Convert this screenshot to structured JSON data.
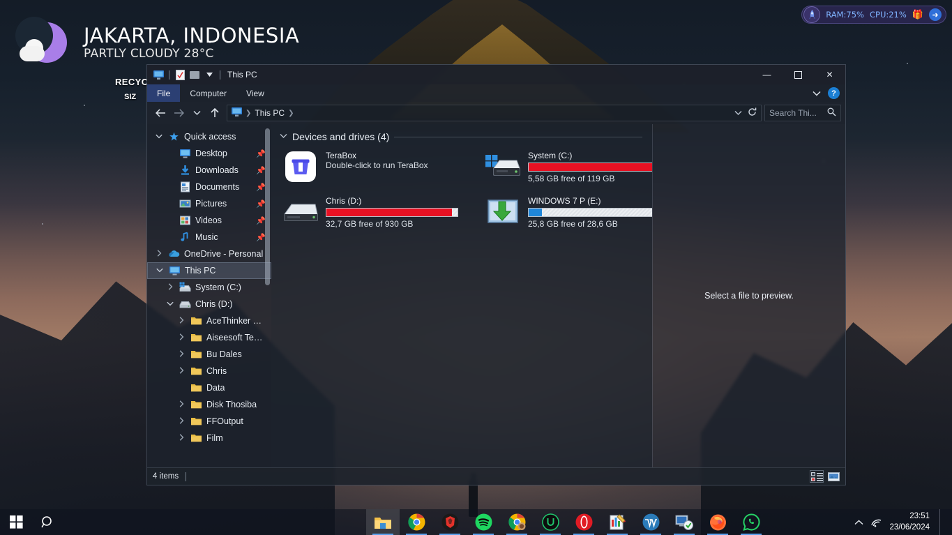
{
  "desktop": {
    "weather": {
      "icon": "moon-cloud-icon",
      "city": "JAKARTA, INDONESIA",
      "condition": "PARTLY CLOUDY 28°C"
    },
    "recycle_bin": {
      "label": "RECYC",
      "size_label": "SIZ"
    },
    "system_monitor": {
      "badge_icon": "rocket-icon",
      "ram": "RAM:75%",
      "cpu": "CPU:21%",
      "gift_icon": "gift-icon",
      "arrow_icon": "arrow-right-icon",
      "accent": "#7fb3ff"
    }
  },
  "window": {
    "title": "This PC",
    "quick_access_toolbar": [
      {
        "name": "this-pc-icon",
        "icon": "monitor-icon"
      },
      {
        "name": "properties-icon",
        "icon": "document-check-icon"
      },
      {
        "name": "new-folder-icon",
        "icon": "folder-icon"
      },
      {
        "name": "customize-qat-icon",
        "icon": "chevron-down-icon"
      }
    ],
    "controls": {
      "minimize": "—",
      "maximize": "▢",
      "close": "✕"
    },
    "ribbon": {
      "tabs": [
        {
          "label": "File",
          "active": true
        },
        {
          "label": "Computer",
          "active": false
        },
        {
          "label": "View",
          "active": false
        }
      ],
      "collapse_icon": "chevron-down-icon",
      "help_label": "?"
    },
    "address_bar": {
      "back_icon": "arrow-left-icon",
      "forward_icon": "arrow-right-icon",
      "recent_icon": "chevron-down-icon",
      "up_icon": "arrow-up-icon",
      "crumb_icon": "monitor-icon",
      "breadcrumbs": [
        "This PC"
      ],
      "history_icon": "chevron-down-icon",
      "refresh_icon": "refresh-icon",
      "search_placeholder": "Search Thi...",
      "search_value": "",
      "search_icon": "search-icon"
    },
    "nav_pane": {
      "items": [
        {
          "label": "Quick access",
          "icon": "star-pin-icon",
          "chevron": "expanded",
          "indent": 0,
          "pinned": false,
          "selected": false
        },
        {
          "label": "Desktop",
          "icon": "desktop-icon",
          "chevron": "none",
          "indent": 1,
          "pinned": true,
          "selected": false
        },
        {
          "label": "Downloads",
          "icon": "downloads-icon",
          "chevron": "none",
          "indent": 1,
          "pinned": true,
          "selected": false
        },
        {
          "label": "Documents",
          "icon": "documents-icon",
          "chevron": "none",
          "indent": 1,
          "pinned": true,
          "selected": false
        },
        {
          "label": "Pictures",
          "icon": "pictures-icon",
          "chevron": "none",
          "indent": 1,
          "pinned": true,
          "selected": false
        },
        {
          "label": "Videos",
          "icon": "videos-icon",
          "chevron": "none",
          "indent": 1,
          "pinned": true,
          "selected": false
        },
        {
          "label": "Music",
          "icon": "music-icon",
          "chevron": "none",
          "indent": 1,
          "pinned": true,
          "selected": false
        },
        {
          "label": "OneDrive - Personal",
          "icon": "onedrive-icon",
          "chevron": "collapsed",
          "indent": 0,
          "pinned": false,
          "selected": false
        },
        {
          "label": "This PC",
          "icon": "monitor-icon",
          "chevron": "expanded",
          "indent": 0,
          "pinned": false,
          "selected": true
        },
        {
          "label": "System (C:)",
          "icon": "windows-drive-icon",
          "chevron": "collapsed",
          "indent": 1,
          "pinned": false,
          "selected": false
        },
        {
          "label": "Chris (D:)",
          "icon": "drive-icon",
          "chevron": "expanded",
          "indent": 1,
          "pinned": false,
          "selected": false
        },
        {
          "label": "AceThinker Temp",
          "icon": "folder-icon",
          "chevron": "collapsed",
          "indent": 2,
          "pinned": false,
          "selected": false
        },
        {
          "label": "Aiseesoft Temp",
          "icon": "folder-icon",
          "chevron": "collapsed",
          "indent": 2,
          "pinned": false,
          "selected": false
        },
        {
          "label": "Bu Dales",
          "icon": "folder-icon",
          "chevron": "collapsed",
          "indent": 2,
          "pinned": false,
          "selected": false
        },
        {
          "label": "Chris",
          "icon": "folder-icon",
          "chevron": "collapsed",
          "indent": 2,
          "pinned": false,
          "selected": false
        },
        {
          "label": "Data",
          "icon": "folder-icon",
          "chevron": "none",
          "indent": 2,
          "pinned": false,
          "selected": false
        },
        {
          "label": "Disk Thosiba",
          "icon": "folder-icon",
          "chevron": "collapsed",
          "indent": 2,
          "pinned": false,
          "selected": false
        },
        {
          "label": "FFOutput",
          "icon": "folder-icon",
          "chevron": "collapsed",
          "indent": 2,
          "pinned": false,
          "selected": false
        },
        {
          "label": "Film",
          "icon": "folder-icon",
          "chevron": "collapsed",
          "indent": 2,
          "pinned": false,
          "selected": false
        }
      ]
    },
    "content": {
      "group_title": "Devices and drives (4)",
      "group_chevron": "expanded",
      "tiles": [
        {
          "name": "TeraBox",
          "subtitle": "Double-click to run TeraBox",
          "icon": "terabox-icon",
          "has_bar": false
        },
        {
          "name": "System (C:)",
          "subtitle": "5,58 GB free of 119 GB",
          "icon": "windows-drive-icon",
          "has_bar": true,
          "fill_percent": 95,
          "fill_color": "#e81123"
        },
        {
          "name": "Chris (D:)",
          "subtitle": "32,7 GB free of 930 GB",
          "icon": "external-drive-icon",
          "has_bar": true,
          "fill_percent": 96,
          "fill_color": "#e81123"
        },
        {
          "name": "WINDOWS 7 P (E:)",
          "subtitle": "25,8 GB free of 28,6 GB",
          "icon": "recovery-drive-icon",
          "has_bar": true,
          "fill_percent": 10,
          "fill_color": "#1f86d9"
        }
      ]
    },
    "preview_pane": {
      "text": "Select a file to preview."
    },
    "status_bar": {
      "item_count": "4 items",
      "details_view_icon": "details-view-icon",
      "large_icons_view_icon": "large-icons-view-icon"
    }
  },
  "taskbar": {
    "start_icon": "windows-start-icon",
    "search_icon": "search-icon",
    "apps": [
      {
        "name": "file-explorer-icon",
        "active": true,
        "running": true
      },
      {
        "name": "google-chrome-icon",
        "active": false,
        "running": true
      },
      {
        "name": "brave-shield-icon",
        "active": false,
        "running": true
      },
      {
        "name": "spotify-icon",
        "active": false,
        "running": true
      },
      {
        "name": "chrome-profile-icon",
        "active": false,
        "running": true
      },
      {
        "name": "utorrent-icon",
        "active": false,
        "running": true
      },
      {
        "name": "opera-icon",
        "active": false,
        "running": true
      },
      {
        "name": "notepad-chart-icon",
        "active": false,
        "running": true
      },
      {
        "name": "wordpress-icon",
        "active": false,
        "running": true
      },
      {
        "name": "remote-desktop-icon",
        "active": false,
        "running": true
      },
      {
        "name": "firefox-icon",
        "active": false,
        "running": true
      },
      {
        "name": "whatsapp-icon",
        "active": false,
        "running": true
      }
    ],
    "tray": {
      "expand_icon": "chevron-up-icon",
      "network_icon": "wifi-icon",
      "time": "23:51",
      "date": "23/06/2024"
    }
  }
}
